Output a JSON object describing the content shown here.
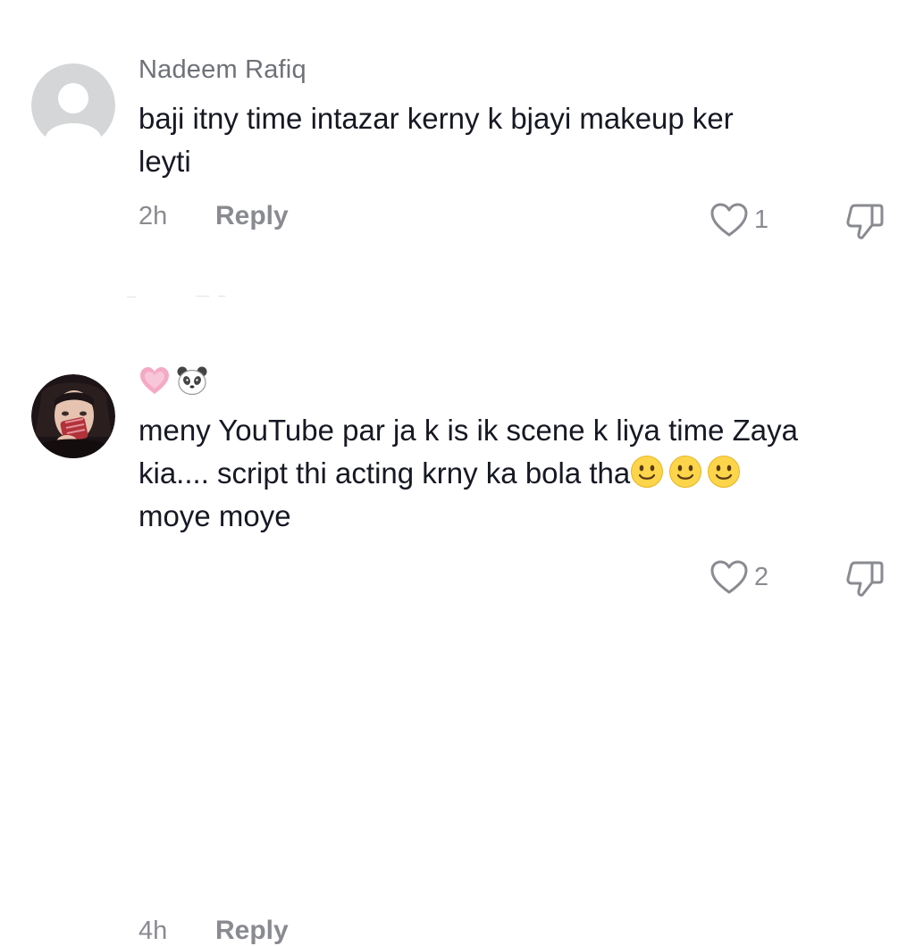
{
  "comments": [
    {
      "username": "Nadeem Rafiq",
      "avatar": "default-avatar",
      "lines": [
        "baji itny time intazar kerny k bjayi makeup ker",
        "leyti"
      ],
      "time": "2h",
      "reply_label": "Reply",
      "like_count": "1",
      "icons": [
        "heart-outline-icon",
        "thumbs-down-icon"
      ]
    },
    {
      "username_emojis": [
        "pink-heart",
        "panda-face"
      ],
      "avatar": "profile-photo",
      "lines": [
        "meny YouTube par ja k is ik scene k liya time Zaya",
        "kia.... script thi acting krny ka bola tha",
        "moye moye"
      ],
      "emojis_after_line_2": [
        "slightly-smiling-face",
        "slightly-smiling-face",
        "slightly-smiling-face"
      ],
      "time": "4h",
      "reply_label": "Reply",
      "like_count": "2",
      "icons": [
        "heart-outline-icon",
        "thumbs-down-icon"
      ]
    }
  ],
  "colors": {
    "primary_text": "#161823",
    "secondary_text": "#8a8b91",
    "username": "#6f7178",
    "default_avatar_bg": "#d5d6d8"
  }
}
